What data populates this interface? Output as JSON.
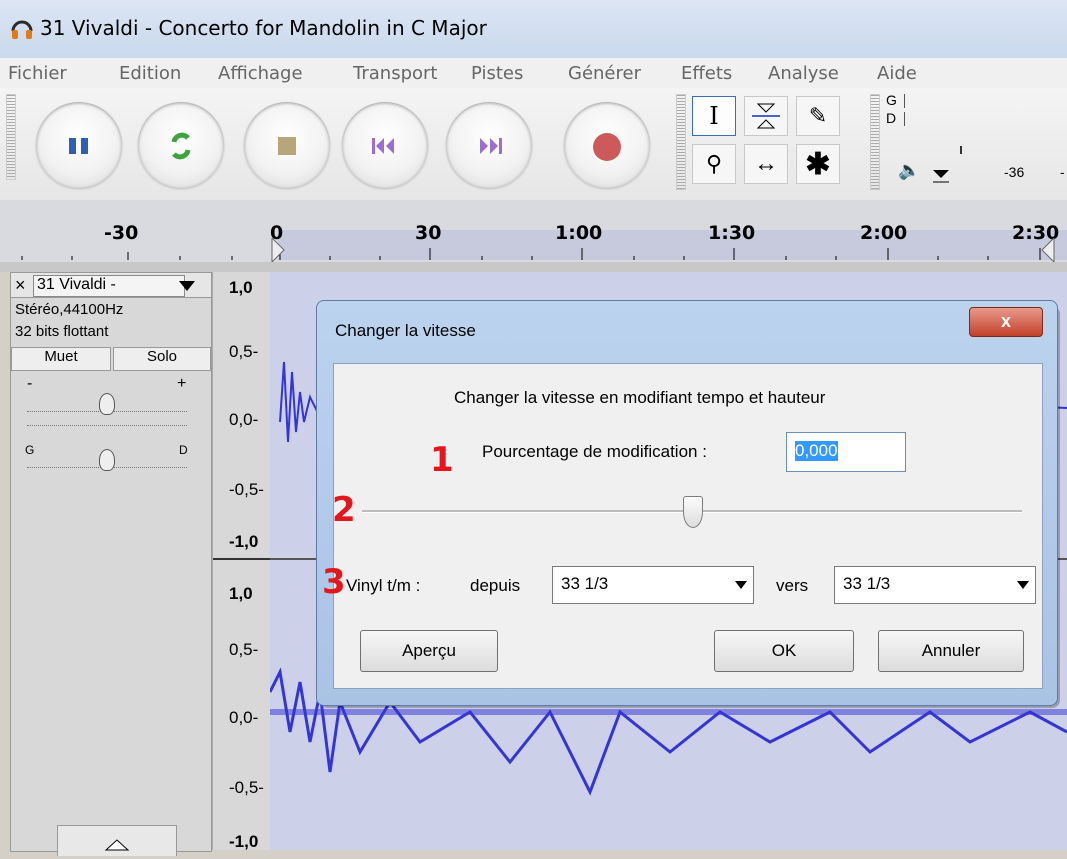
{
  "window": {
    "title": "31 Vivaldi - Concerto for Mandolin in C Major"
  },
  "menu": [
    "Fichier",
    "Edition",
    "Affichage",
    "Transport",
    "Pistes",
    "Générer",
    "Effets",
    "Analyse",
    "Aide"
  ],
  "meter": {
    "left": "G",
    "right": "D",
    "scale_value": "-36",
    "scale_value2": "-"
  },
  "ruler": {
    "ticks": [
      "-30",
      "0",
      "30",
      "1:00",
      "1:30",
      "2:00",
      "2:30"
    ]
  },
  "track": {
    "name": "31 Vivaldi -",
    "format": "Stéréo,44100Hz",
    "bits": "32 bits flottant",
    "mute": "Muet",
    "solo": "Solo",
    "gain_minus": "-",
    "gain_plus": "+",
    "pan_left": "G",
    "pan_right": "D",
    "close": "×"
  },
  "scale": {
    "top": [
      "1,0",
      "0,5-",
      "0,0-",
      "-0,5-",
      "-1,0"
    ],
    "bottom": [
      "1,0",
      "0,5-",
      "0,0-",
      "-0,5-",
      "-1,0"
    ]
  },
  "dialog": {
    "title": "Changer la vitesse",
    "close": "x",
    "heading": "Changer la vitesse en modifiant tempo et hauteur",
    "percent_label": "Pourcentage de modification :",
    "percent_value": "0,000",
    "slider_value": 0.5,
    "vinyl_label": "Vinyl t/m :",
    "from_label": "depuis",
    "from_value": "33 1/3",
    "to_label": "vers",
    "to_value": "33 1/3",
    "preview_button": "Aperçu",
    "ok_button": "OK",
    "cancel_button": "Annuler"
  },
  "annotations": [
    "1",
    "2",
    "3"
  ],
  "colors": {
    "wave": "#3535d6",
    "annotation": "#e4151b",
    "dialog_frame": "#a9c3e4"
  }
}
